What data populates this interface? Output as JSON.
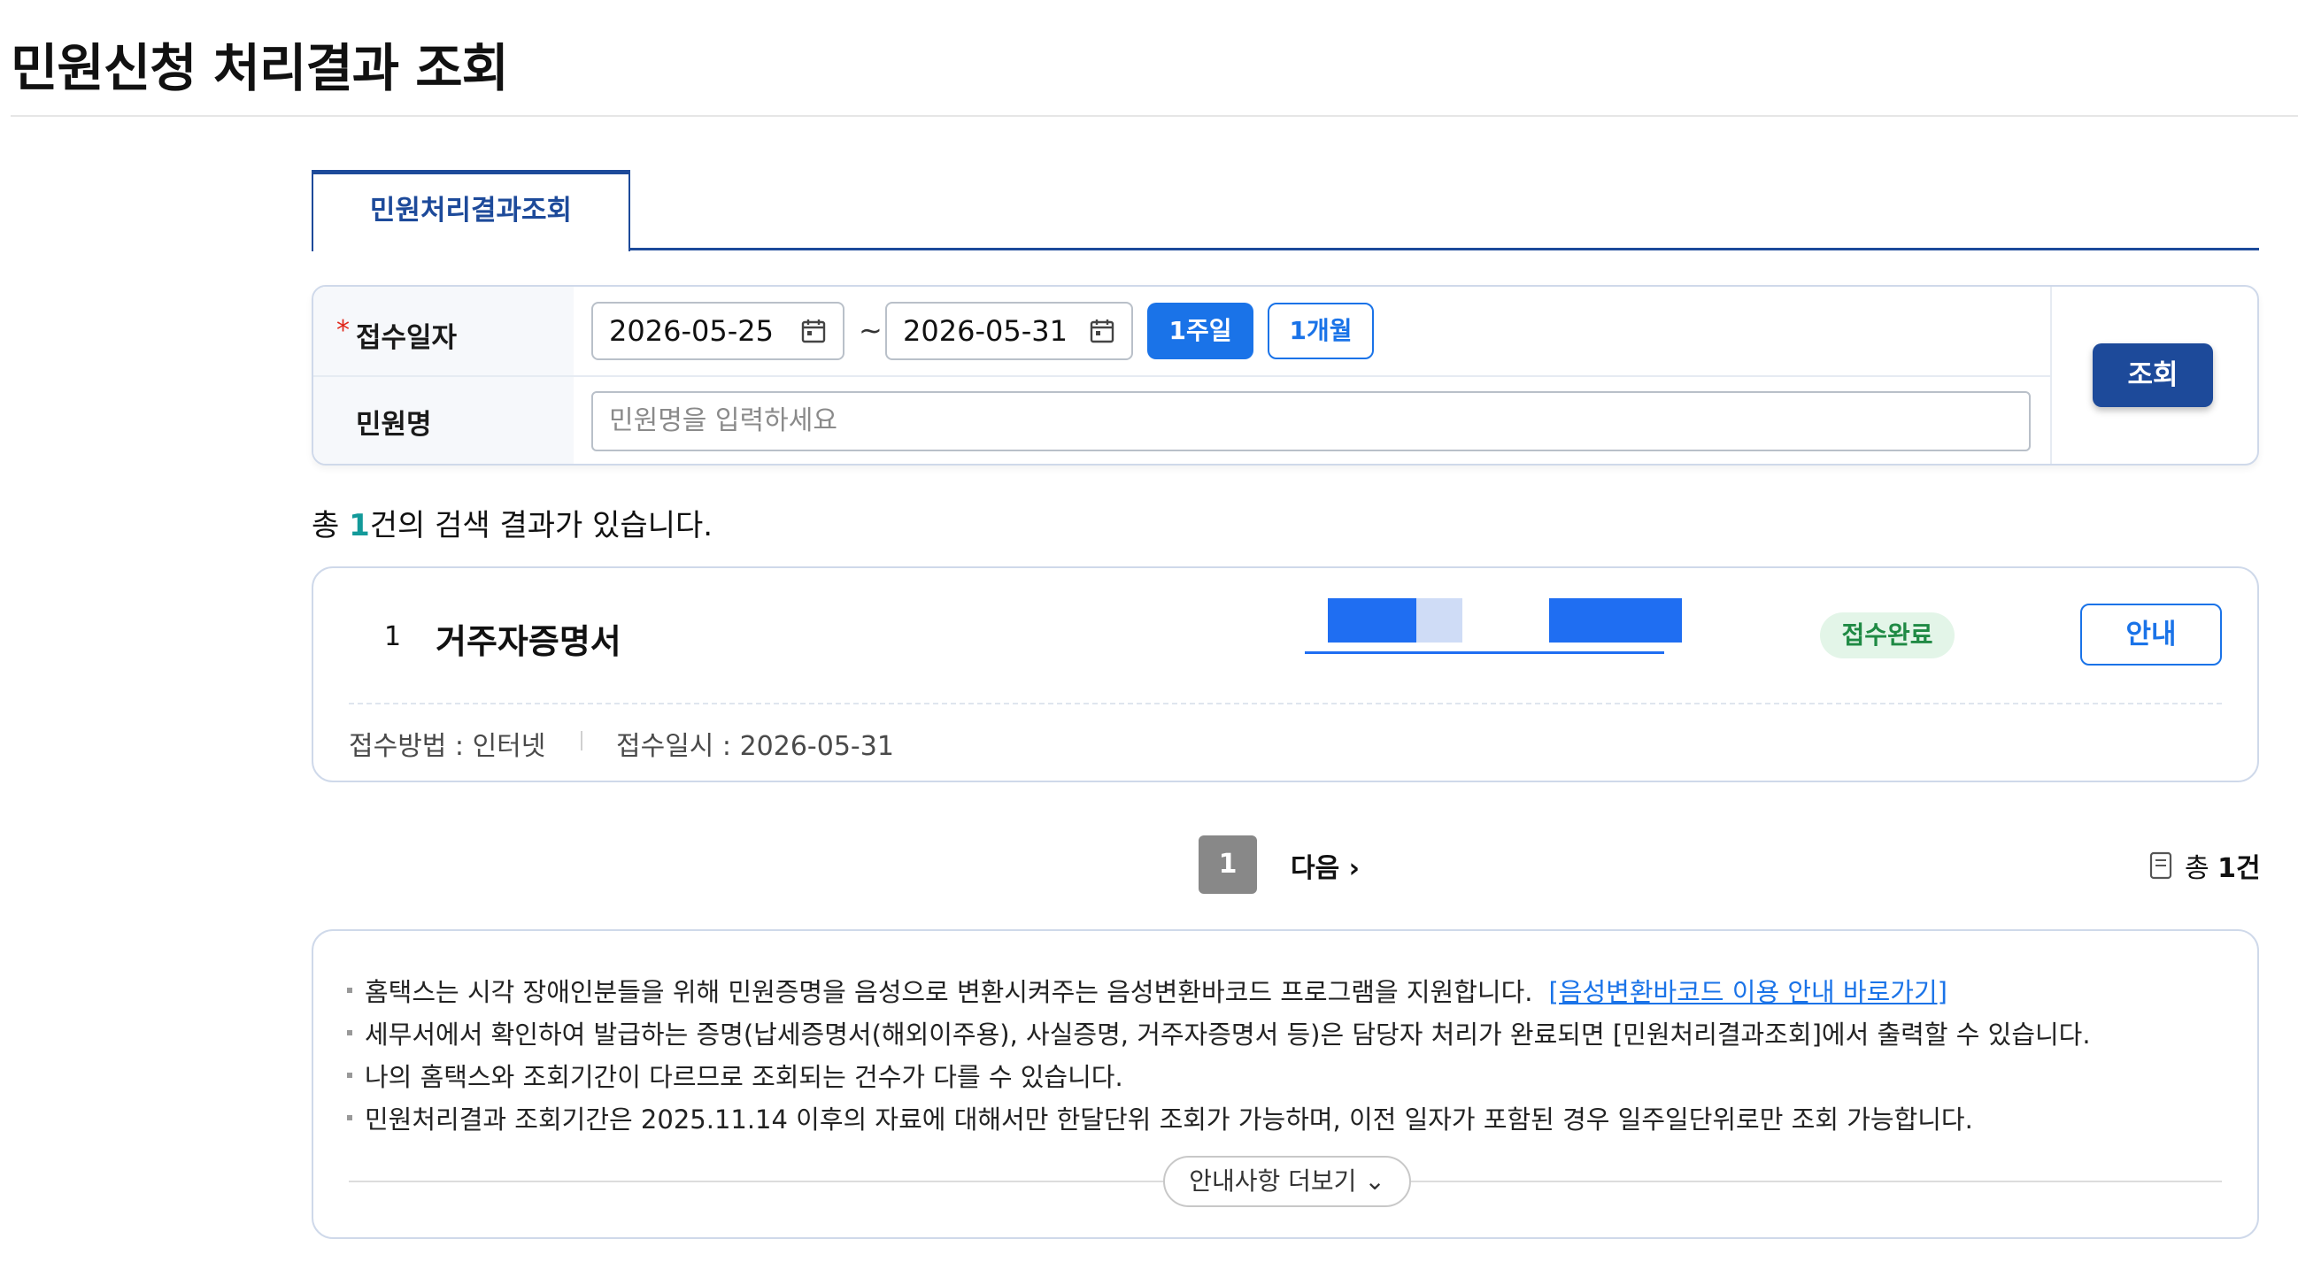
{
  "page": {
    "title": "민원신청 처리결과 조회"
  },
  "tabs": [
    {
      "label": "민원처리결과조회"
    }
  ],
  "search": {
    "required_mark": "*",
    "date_label": "접수일자",
    "date_from": "2026-05-25",
    "date_sep": "~",
    "date_to": "2026-05-31",
    "week_button": "1주일",
    "month_button": "1개월",
    "name_label": "민원명",
    "name_placeholder": "민원명을 입력하세요",
    "search_button": "조회"
  },
  "summary": {
    "prefix": "총 ",
    "count": "1",
    "suffix": "건의 검색 결과가 있습니다."
  },
  "results": [
    {
      "no": "1",
      "title": "거주자증명서",
      "status": "접수완료",
      "info_button": "안내",
      "method": "접수방법 : 인터넷",
      "date": "접수일시 : 2026-05-31"
    }
  ],
  "pagination": {
    "current": "1",
    "next": "다음 ›",
    "total_prefix": "총 ",
    "total_count": "1건"
  },
  "notice": {
    "items": [
      "홈택스는 시각 장애인분들을 위해 민원증명을 음성으로 변환시켜주는 음성변환바코드 프로그램을 지원합니다.",
      "세무서에서 확인하여 발급하는 증명(납세증명서(해외이주용), 사실증명, 거주자증명서 등)은 담당자 처리가 완료되면 [민원처리결과조회]에서 출력할 수 있습니다.",
      "나의 홈택스와 조회기간이 다르므로 조회되는 건수가 다를 수 있습니다.",
      "민원처리결과 조회기간은 2025.11.14 이후의 자료에 대해서만 한달단위 조회가 가능하며, 이전 일자가 포함된 경우 일주일단위로만 조회 가능합니다."
    ],
    "link": "[음성변환바코드 이용 안내 바로가기]",
    "more_button": "안내사항 더보기 ⌄"
  },
  "icons": {
    "calendar": "calendar-icon",
    "document": "document-icon",
    "chevron": "chevron-down-icon"
  },
  "colors": {
    "primary": "#1d4a9a",
    "accent": "#1a73e8",
    "success": "#1f8a44",
    "count": "#139a9a"
  }
}
